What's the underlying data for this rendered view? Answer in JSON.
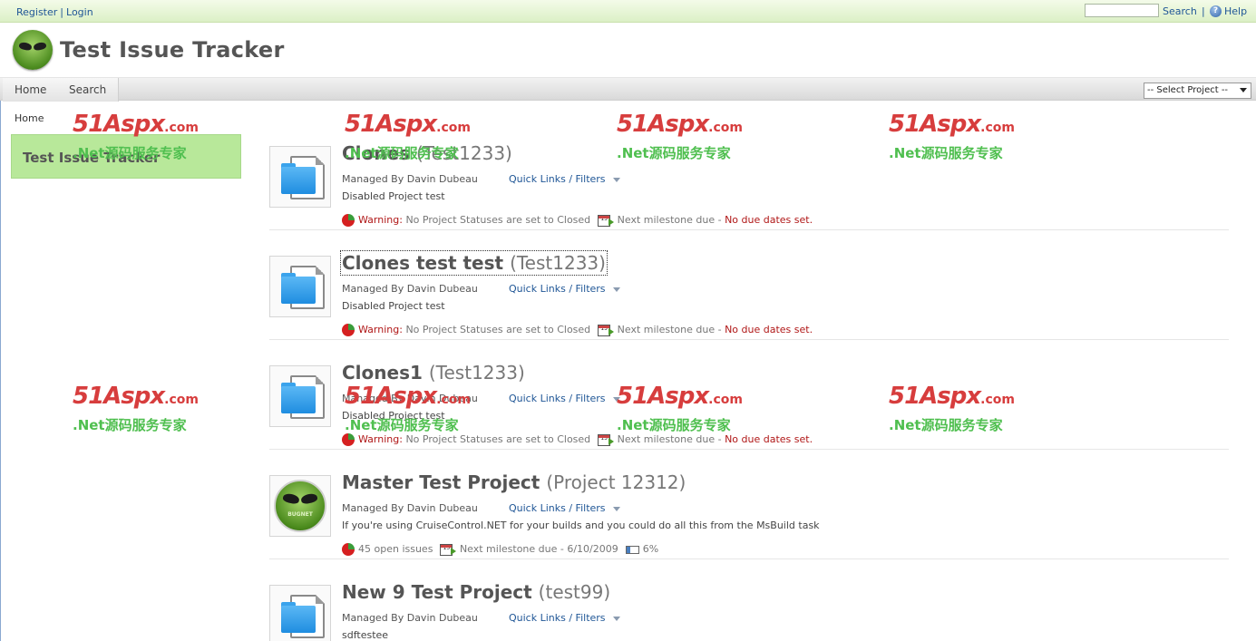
{
  "topbar": {
    "register": "Register",
    "separator": "|",
    "login": "Login",
    "search_link": "Search",
    "help_icon_glyph": "?",
    "help": "Help"
  },
  "header": {
    "title": "Test Issue Tracker",
    "logo_icon": "bugnet-logo"
  },
  "nav": {
    "home": "Home",
    "search": "Search",
    "project_select": "-- Select Project --"
  },
  "breadcrumb": "Home",
  "sidebar": {
    "title": "Test Issue Tracker"
  },
  "watermark": {
    "brand": "51Aspx",
    "dotcom": ".com",
    "sub": ".Net源码服务专家"
  },
  "projects": [
    {
      "name": "Clones",
      "code": "(Test1233)",
      "manager": "Managed By Davin Dubeau",
      "links": "Quick Links / Filters",
      "description": "Disabled Project test",
      "status_warning": "Warning:",
      "status_text": "No Project Statuses are set to Closed",
      "milestone": "Next milestone due -",
      "due": "No due dates set.",
      "icon": "folder-document-icon"
    },
    {
      "name": "Clones test test",
      "code": "(Test1233)",
      "manager": "Managed By Davin Dubeau",
      "links": "Quick Links / Filters",
      "description": "Disabled Project test",
      "status_warning": "Warning:",
      "status_text": "No Project Statuses are set to Closed",
      "milestone": "Next milestone due -",
      "due": "No due dates set.",
      "icon": "folder-document-icon"
    },
    {
      "name": "Clones1",
      "code": "(Test1233)",
      "manager": "Managed By Davin Dubeau",
      "links": "Quick Links / Filters",
      "description": "Disabled Project test",
      "status_warning": "Warning:",
      "status_text": "No Project Statuses are set to Closed",
      "milestone": "Next milestone due -",
      "due": "No due dates set.",
      "icon": "folder-document-icon"
    },
    {
      "name": "Master Test Project",
      "code": "(Project 12312)",
      "manager": "Managed By Davin Dubeau",
      "links": "Quick Links / Filters",
      "description": "If you're using CruiseControl.NET for your builds and you could do all this from the MsBuild task",
      "open_issues": "45 open issues",
      "milestone": "Next milestone due - 6/10/2009",
      "progress": "6%",
      "icon": "bugnet-project-icon",
      "icon_text": "BUGNET"
    },
    {
      "name": "New 9 Test Project",
      "code": "(test99)",
      "manager": "Managed By Davin Dubeau",
      "links": "Quick Links / Filters",
      "description": "sdftestee",
      "icon": "folder-document-icon"
    }
  ],
  "calendar_icon_text": "15",
  "colors": {
    "topbar": "#dcf0c6",
    "sidebox": "#b8e89a",
    "link": "#1f5696",
    "warning": "#b01717"
  }
}
